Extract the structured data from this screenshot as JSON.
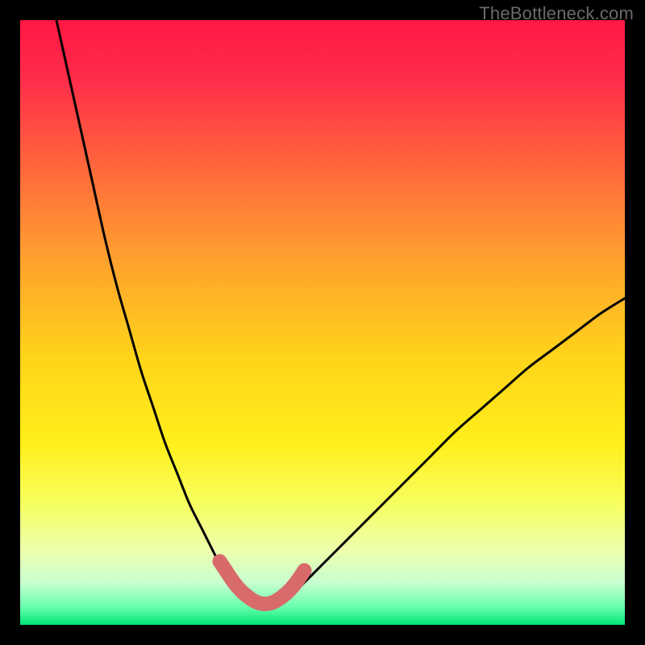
{
  "watermark": "TheBottleneck.com",
  "colors": {
    "frame": "#000000",
    "curve_stroke": "#000000",
    "bump_stroke": "#d86a6a"
  },
  "gradient_stops": [
    {
      "pos": 0.0,
      "color": "#ff1744"
    },
    {
      "pos": 0.1,
      "color": "#ff2e4a"
    },
    {
      "pos": 0.25,
      "color": "#ff6a3a"
    },
    {
      "pos": 0.4,
      "color": "#ffa22e"
    },
    {
      "pos": 0.55,
      "color": "#ffd21a"
    },
    {
      "pos": 0.7,
      "color": "#ffef1a"
    },
    {
      "pos": 0.8,
      "color": "#f6ff60"
    },
    {
      "pos": 0.88,
      "color": "#ecffb0"
    },
    {
      "pos": 0.93,
      "color": "#c8ffd0"
    },
    {
      "pos": 0.97,
      "color": "#6affae"
    },
    {
      "pos": 1.0,
      "color": "#00e676"
    }
  ],
  "chart_data": {
    "type": "line",
    "title": "",
    "xlabel": "",
    "ylabel": "",
    "xlim": [
      0,
      100
    ],
    "ylim": [
      0,
      100
    ],
    "grid": false,
    "legend": false,
    "x": [
      6,
      8,
      10,
      12,
      14,
      16,
      18,
      20,
      22,
      24,
      26,
      28,
      30,
      32,
      33,
      34,
      35,
      36,
      37,
      38,
      39,
      40,
      41,
      42,
      43,
      45,
      47,
      50,
      53,
      56,
      60,
      64,
      68,
      72,
      76,
      80,
      84,
      88,
      92,
      96,
      100
    ],
    "series": [
      {
        "name": "bottleneck-curve",
        "values": [
          100,
          91,
          82,
          73,
          64,
          56,
          49,
          42,
          36,
          30,
          25,
          20,
          16,
          12,
          10,
          8,
          7,
          6,
          5,
          4,
          3.5,
          3,
          3,
          3,
          3.5,
          5,
          7,
          10,
          13,
          16,
          20,
          24,
          28,
          32,
          35.5,
          39,
          42.5,
          45.5,
          48.5,
          51.5,
          54
        ]
      }
    ],
    "annotations": [
      {
        "name": "salmon-bump",
        "x": [
          33,
          34,
          35,
          36,
          37,
          38,
          39,
          40,
          41,
          42,
          43,
          44,
          45,
          46,
          47
        ],
        "values": [
          10.5,
          9,
          7.5,
          6.2,
          5.2,
          4.4,
          3.8,
          3.5,
          3.5,
          3.8,
          4.4,
          5.2,
          6.2,
          7.5,
          9
        ]
      }
    ],
    "watermark": "TheBottleneck.com"
  }
}
